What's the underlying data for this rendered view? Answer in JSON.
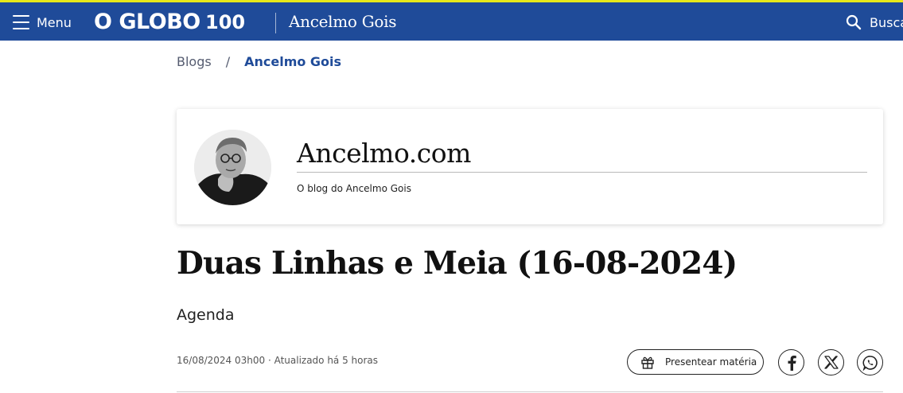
{
  "header": {
    "menu_label": "Menu",
    "logo_text": "O GLOBO",
    "logo_badge": "100",
    "section_title": "Ancelmo Gois",
    "search_label": "Busca",
    "bar_color": "#1f4b99",
    "accent_stripe_color": "#e7e81a"
  },
  "breadcrumb": {
    "items": [
      "Blogs",
      "Ancelmo Gois"
    ],
    "separator": "/"
  },
  "blog_card": {
    "title": "Ancelmo.com",
    "subtitle": "O blog do Ancelmo Gois"
  },
  "article": {
    "headline": "Duas Linhas e Meia (16-08-2024)",
    "subtitle": "Agenda",
    "meta": "16/08/2024 03h00 · Atualizado há 5 horas"
  },
  "actions": {
    "gift_label": "Presentear matéria",
    "share_icons": [
      "facebook-icon",
      "x-icon",
      "whatsapp-icon"
    ]
  }
}
